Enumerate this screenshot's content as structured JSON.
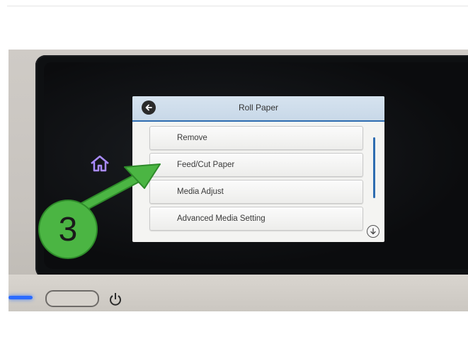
{
  "screen": {
    "title": "Roll Paper",
    "menu_items": [
      {
        "label": "Remove"
      },
      {
        "label": "Feed/Cut Paper"
      },
      {
        "label": "Media Adjust"
      },
      {
        "label": "Advanced Media Setting"
      }
    ]
  },
  "callout": {
    "step_number": "3"
  },
  "icons": {
    "back": "back-arrow-icon",
    "home": "home-icon",
    "scroll_down": "chevron-down-icon",
    "power": "power-icon"
  },
  "colors": {
    "accent": "#2f6db1",
    "callout_green": "#4bb543",
    "home_icon": "#a98bff",
    "led": "#2b6bff"
  }
}
